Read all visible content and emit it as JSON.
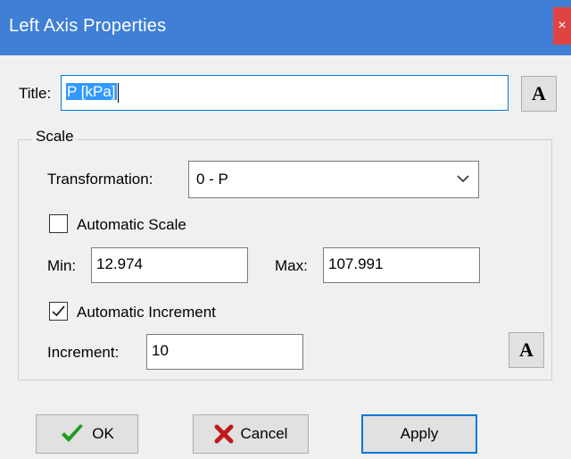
{
  "window": {
    "title": "Left Axis Properties",
    "close_glyph": "×"
  },
  "title_field": {
    "label": "Title:",
    "value": "P [kPa]"
  },
  "font_button_glyph": "A",
  "scale": {
    "legend": "Scale",
    "transformation": {
      "label": "Transformation:",
      "value": "0 - P"
    },
    "automatic_scale": {
      "label": "Automatic Scale",
      "checked": false
    },
    "min": {
      "label": "Min:",
      "value": "12.974"
    },
    "max": {
      "label": "Max:",
      "value": "107.991"
    },
    "automatic_increment": {
      "label": "Automatic Increment",
      "checked": true
    },
    "increment": {
      "label": "Increment:",
      "value": "10"
    }
  },
  "buttons": {
    "ok": "OK",
    "cancel": "Cancel",
    "apply": "Apply"
  },
  "colors": {
    "titlebar": "#3f7fd5",
    "close": "#e04343",
    "ok_check": "#1e9c1e",
    "cancel_x": "#c0191b",
    "selection": "#3399ff"
  },
  "icons": {
    "ok": "green-checkmark-icon",
    "cancel": "red-x-icon",
    "font": "font-a-icon"
  }
}
